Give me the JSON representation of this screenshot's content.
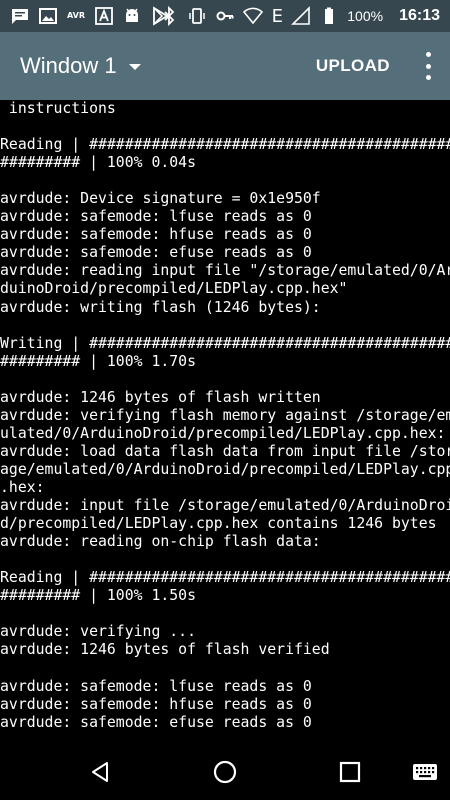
{
  "status_bar": {
    "battery_level": "100%",
    "time": "16:13",
    "e_label": "E",
    "avr_label": "AVR",
    "notification_icons": [
      "message-icon",
      "image-icon",
      "avr-app-icon",
      "font-app-icon",
      "android-icon",
      "play-store-icon"
    ],
    "system_icons": [
      "bluetooth-icon",
      "vibrate-icon",
      "key-icon",
      "wifi-icon",
      "signal-icon",
      "battery-icon"
    ]
  },
  "app_bar": {
    "window_label": "Window 1",
    "upload_label": "UPLOAD"
  },
  "console": {
    "lines": [
      " instructions",
      "",
      "Reading | ################################################",
      "######### | 100% 0.04s",
      "",
      "avrdude: Device signature = 0x1e950f",
      "avrdude: safemode: lfuse reads as 0",
      "avrdude: safemode: hfuse reads as 0",
      "avrdude: safemode: efuse reads as 0",
      "avrdude: reading input file \"/storage/emulated/0/Ar",
      "duinoDroid/precompiled/LEDPlay.cpp.hex\"",
      "avrdude: writing flash (1246 bytes):",
      "",
      "Writing | ################################################",
      "######### | 100% 1.70s",
      "",
      "avrdude: 1246 bytes of flash written",
      "avrdude: verifying flash memory against /storage/em",
      "ulated/0/ArduinoDroid/precompiled/LEDPlay.cpp.hex:",
      "avrdude: load data flash data from input file /stor",
      "age/emulated/0/ArduinoDroid/precompiled/LEDPlay.cpp",
      ".hex:",
      "avrdude: input file /storage/emulated/0/ArduinoDroi",
      "d/precompiled/LEDPlay.cpp.hex contains 1246 bytes",
      "avrdude: reading on-chip flash data:",
      "",
      "Reading | ################################################",
      "######### | 100% 1.50s",
      "",
      "avrdude: verifying ...",
      "avrdude: 1246 bytes of flash verified",
      "",
      "avrdude: safemode: lfuse reads as 0",
      "avrdude: safemode: hfuse reads as 0",
      "avrdude: safemode: efuse reads as 0",
      ""
    ]
  },
  "nav_bar": {
    "buttons": [
      "back-icon",
      "home-icon",
      "recents-icon",
      "keyboard-icon"
    ]
  },
  "colors": {
    "status_bar_bg": "#37474F",
    "app_bar_bg": "#546E7A",
    "console_bg": "#000000",
    "console_text": "#FFFFFF"
  }
}
